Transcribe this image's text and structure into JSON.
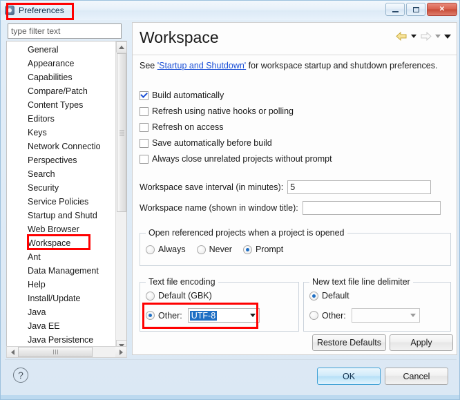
{
  "window": {
    "title": "Preferences",
    "icon": "eclipse-preferences-icon",
    "minimize_label": "Minimize",
    "maximize_label": "Maximize",
    "close_label": "Close"
  },
  "sidebar": {
    "filter": {
      "placeholder": "type filter text",
      "value": ""
    },
    "items": [
      {
        "label": "General",
        "level": 0,
        "selected": false
      },
      {
        "label": "Appearance",
        "level": 1,
        "selected": false
      },
      {
        "label": "Capabilities",
        "level": 1,
        "selected": false
      },
      {
        "label": "Compare/Patch",
        "level": 1,
        "selected": false
      },
      {
        "label": "Content Types",
        "level": 1,
        "selected": false
      },
      {
        "label": "Editors",
        "level": 1,
        "selected": false
      },
      {
        "label": "Keys",
        "level": 1,
        "selected": false
      },
      {
        "label": "Network Connectio",
        "level": 1,
        "selected": false
      },
      {
        "label": "Perspectives",
        "level": 1,
        "selected": false
      },
      {
        "label": "Search",
        "level": 1,
        "selected": false
      },
      {
        "label": "Security",
        "level": 1,
        "selected": false
      },
      {
        "label": "Service Policies",
        "level": 1,
        "selected": false
      },
      {
        "label": "Startup and Shutd",
        "level": 1,
        "selected": false
      },
      {
        "label": "Web Browser",
        "level": 1,
        "selected": false
      },
      {
        "label": "Workspace",
        "level": 1,
        "selected": true
      },
      {
        "label": "Ant",
        "level": 0,
        "selected": false
      },
      {
        "label": "Data Management",
        "level": 0,
        "selected": false
      },
      {
        "label": "Help",
        "level": 0,
        "selected": false
      },
      {
        "label": "Install/Update",
        "level": 0,
        "selected": false
      },
      {
        "label": "Java",
        "level": 0,
        "selected": false
      },
      {
        "label": "Java EE",
        "level": 0,
        "selected": false
      },
      {
        "label": "Java Persistence",
        "level": 0,
        "selected": false
      }
    ]
  },
  "main": {
    "title": "Workspace",
    "nav": {
      "back_icon": "back-arrow-icon",
      "back_menu_icon": "chevron-down-icon",
      "forward_icon": "forward-arrow-icon",
      "forward_menu_icon": "chevron-down-icon",
      "menu_icon": "chevron-down-icon"
    },
    "description": {
      "prefix": "See ",
      "link": "'Startup and Shutdown'",
      "suffix": " for workspace startup and shutdown preferences."
    },
    "checkboxes": [
      {
        "label": "Build automatically",
        "checked": true
      },
      {
        "label": "Refresh using native hooks or polling",
        "checked": false
      },
      {
        "label": "Refresh on access",
        "checked": false
      },
      {
        "label": "Save automatically before build",
        "checked": false
      },
      {
        "label": "Always close unrelated projects without prompt",
        "checked": false
      }
    ],
    "save_interval": {
      "label": "Workspace save interval (in minutes):",
      "value": "5"
    },
    "workspace_name": {
      "label": "Workspace name (shown in window title):",
      "value": ""
    },
    "open_referenced": {
      "title": "Open referenced projects when a project is opened",
      "options": [
        {
          "label": "Always",
          "selected": false
        },
        {
          "label": "Never",
          "selected": false
        },
        {
          "label": "Prompt",
          "selected": true
        }
      ]
    },
    "text_file_encoding": {
      "title": "Text file encoding",
      "default_option": {
        "label": "Default (GBK)",
        "selected": false
      },
      "other_option": {
        "label": "Other:",
        "selected": true
      },
      "combo_value": "UTF-8",
      "combo_arrow_icon": "chevron-down-icon"
    },
    "line_delimiter": {
      "title": "New text file line delimiter",
      "default_option": {
        "label": "Default",
        "selected": true
      },
      "other_option": {
        "label": "Other:",
        "selected": false
      },
      "combo_value": "",
      "combo_arrow_icon": "chevron-down-icon"
    },
    "restore_defaults_label": "Restore Defaults",
    "apply_label": "Apply"
  },
  "footer": {
    "help_icon": "help-question-icon",
    "ok_label": "OK",
    "cancel_label": "Cancel"
  },
  "colors": {
    "annotation": "#ff0000",
    "selection": "#1f6fc4",
    "link": "#1a4fd6",
    "ok_accent": "#3c9fd4"
  }
}
